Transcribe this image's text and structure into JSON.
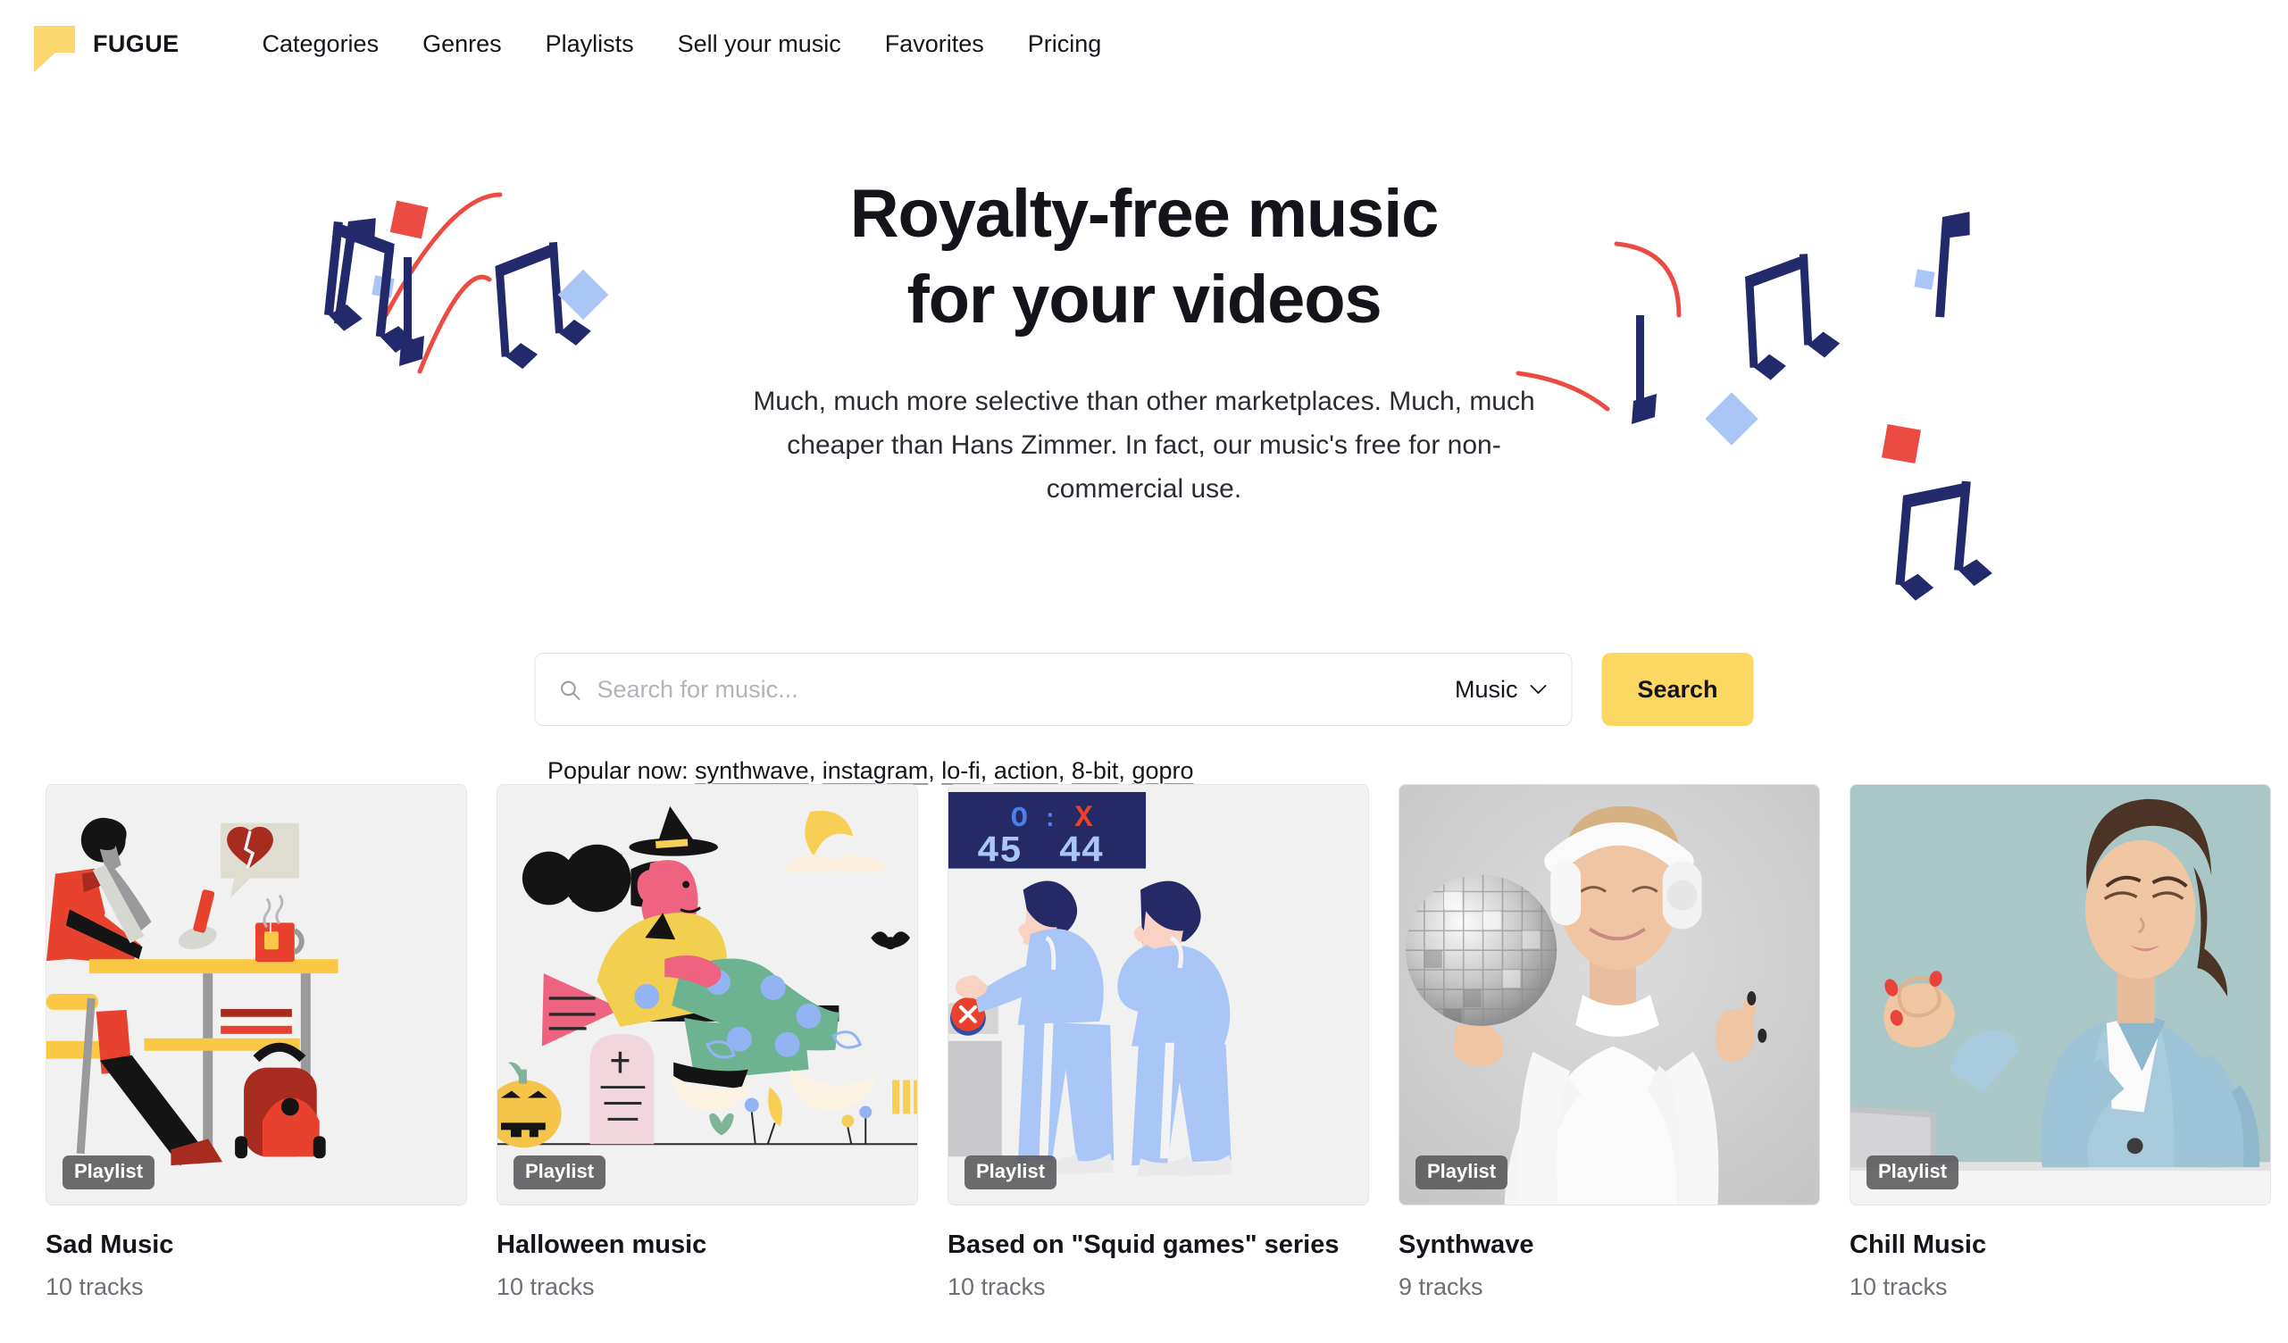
{
  "header": {
    "logo_icon": "flag-logo-icon",
    "brand": "FUGUE",
    "nav": [
      {
        "label": "Categories",
        "name": "nav-categories"
      },
      {
        "label": "Genres",
        "name": "nav-genres"
      },
      {
        "label": "Playlists",
        "name": "nav-playlists"
      },
      {
        "label": "Sell your music",
        "name": "nav-sell-your-music"
      },
      {
        "label": "Favorites",
        "name": "nav-favorites"
      },
      {
        "label": "Pricing",
        "name": "nav-pricing"
      }
    ]
  },
  "hero": {
    "title_line1": "Royalty-free music",
    "title_line2": "for your videos",
    "subtitle": "Much, much more selective than other marketplaces. Much, much cheaper than Hans Zimmer. In fact, our music's free for non-commercial use."
  },
  "search": {
    "icon": "search-icon",
    "placeholder": "Search for music...",
    "value": "",
    "category_selected": "Music",
    "category_chevron": "chevron-down-icon",
    "button_label": "Search"
  },
  "popular": {
    "label": "Popular now:",
    "tags": [
      "synthwave",
      "instagram",
      "lo-fi",
      "action",
      "8-bit",
      "gopro"
    ]
  },
  "cards": [
    {
      "badge": "Playlist",
      "title": "Sad Music",
      "tracks": "10 tracks",
      "art": "sad-music-illustration"
    },
    {
      "badge": "Playlist",
      "title": "Halloween music",
      "tracks": "10 tracks",
      "art": "halloween-witch-illustration"
    },
    {
      "badge": "Playlist",
      "title": "Based on \"Squid games\" series",
      "tracks": "10 tracks",
      "art": "squid-games-illustration",
      "scoreboard": {
        "left": "45",
        "right": "44",
        "o_symbol": "O",
        "colon": ":",
        "x_symbol": "X"
      }
    },
    {
      "badge": "Playlist",
      "title": "Synthwave",
      "tracks": "9 tracks",
      "art": "disco-ball-headphones-photo"
    },
    {
      "badge": "Playlist",
      "title": "Chill Music",
      "tracks": "10 tracks",
      "art": "meditating-woman-photo"
    }
  ],
  "colors": {
    "accent_yellow": "#FCD761",
    "navy": "#232A6B",
    "red": "#EB4B42",
    "light_blue": "#A9C6F7",
    "card_bg": "#F1F1F1",
    "text_dark": "#15141A",
    "text_muted": "#6E6E76"
  }
}
